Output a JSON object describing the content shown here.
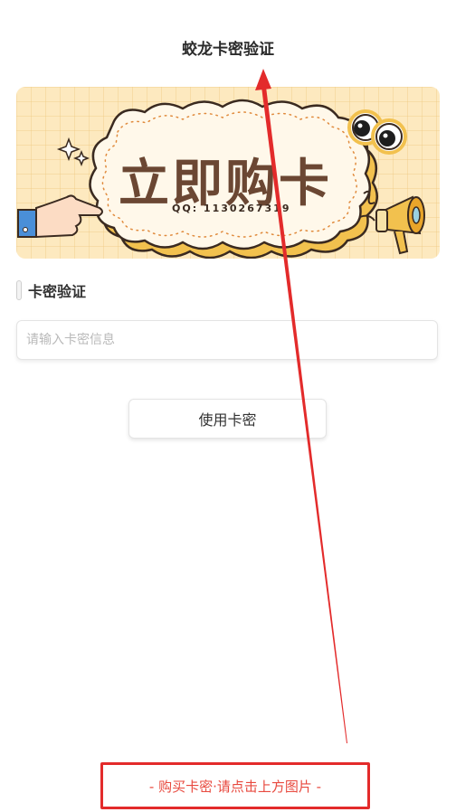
{
  "header": {
    "title": "蛟龙卡密验证"
  },
  "banner": {
    "title": "立即购卡",
    "qq_text": "QQ: 1130267319",
    "icons": [
      "sparkle-icon",
      "pointing-hand-icon",
      "googly-eyes-icon",
      "megaphone-icon"
    ]
  },
  "section": {
    "label": "卡密验证"
  },
  "card_input": {
    "placeholder": "请输入卡密信息",
    "value": ""
  },
  "use_button": {
    "label": "使用卡密"
  },
  "note": {
    "text": "- 购买卡密·请点击上方图片 -"
  },
  "colors": {
    "annotation_red": "#e32b2b",
    "banner_bg": "#fde9bf",
    "banner_text": "#6b4733"
  }
}
